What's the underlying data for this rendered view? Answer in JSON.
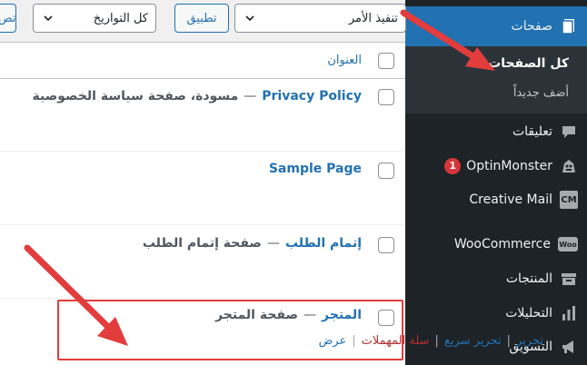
{
  "sidebar": {
    "pages_label": "صفحات",
    "submenu": {
      "all_pages": "كل الصفحات",
      "add_new": "أضف جديداً"
    },
    "items": [
      {
        "label": "تعليقات"
      },
      {
        "label": "OptinMonster",
        "badge": "1"
      },
      {
        "label": "Creative Mail",
        "icon_text": "CM"
      },
      {
        "label": "WooCommerce",
        "icon_text": "Woo"
      },
      {
        "label": "المنتجات"
      },
      {
        "label": "التحليلات"
      },
      {
        "label": "التسويق"
      }
    ]
  },
  "toolbar": {
    "bulk_action": "تنفيذ الأمر",
    "apply": "تطبيق",
    "all_dates": "كل التواريخ",
    "filter_partial": "تص"
  },
  "table": {
    "header_title": "العنوان",
    "rows": [
      {
        "title": "Privacy Policy",
        "dash": "—",
        "state": "مسودة، صفحة سياسة الخصوصية"
      },
      {
        "title": "Sample Page"
      },
      {
        "title": "إتمام الطلب",
        "dash": "—",
        "state": "صفحة إتمام الطلب"
      },
      {
        "title": "المتجر",
        "dash": "—",
        "state": "صفحة المتجر"
      }
    ],
    "row_actions": {
      "edit": "تحرير",
      "quick_edit": "تحرير سريع",
      "trash": "سلة المهملات",
      "view": "عرض",
      "separator": "|"
    }
  },
  "colors": {
    "sidebar_bg": "#1d2327",
    "active_blue": "#2271b1",
    "annotation_red": "#e23c3c"
  }
}
